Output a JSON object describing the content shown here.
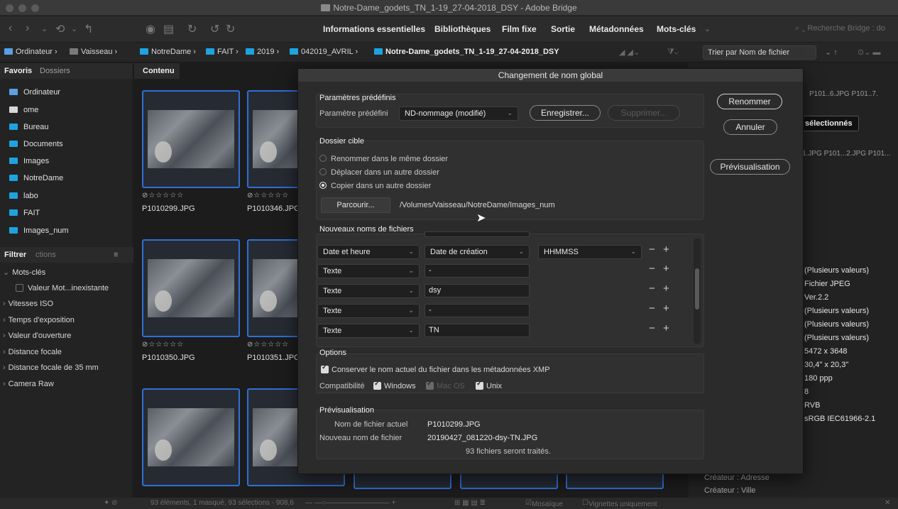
{
  "window": {
    "title": "Notre-Dame_godets_TN_1-19_27-04-2018_DSY - Adobe Bridge"
  },
  "workspaces": [
    "Informations essentielles",
    "Bibliothèques",
    "Film fixe",
    "Sortie",
    "Métadonnées",
    "Mots-clés"
  ],
  "search": {
    "placeholder": "Recherche Bridge : do"
  },
  "path": {
    "crumbs": [
      "Ordinateur",
      "Vaisseau",
      "NotreDame",
      "FAIT",
      "2019",
      "042019_AVRIL",
      "Notre-Dame_godets_TN_1-19_27-04-2018_DSY"
    ]
  },
  "sort": {
    "label": "Trier par Nom de fichier"
  },
  "sidebar": {
    "tabs": [
      "Favoris",
      "Dossiers"
    ],
    "favorites": [
      "Ordinateur",
      "ome",
      "Bureau",
      "Documents",
      "Images",
      "NotreDame",
      "labo",
      "FAIT",
      "Images_num"
    ],
    "filter_tabs": [
      "Filtrer",
      "ctions"
    ],
    "filters": [
      "Mots-clés",
      "Valeur Mot...inexistante",
      "Vitesses ISO",
      "Temps d'exposition",
      "Valeur d'ouverture",
      "Distance focale",
      "Distance focale de 35 mm",
      "Camera Raw"
    ]
  },
  "content": {
    "tab": "Contenu",
    "thumbs": [
      {
        "name": "P1010299.JPG",
        "stars": "⊘☆☆☆☆☆"
      },
      {
        "name": "P1010346.JPG",
        "stars": "⊘☆☆☆☆☆"
      },
      {
        "name": "P1010350.JPG",
        "stars": "⊘☆☆☆☆☆"
      },
      {
        "name": "P1010351.JPG",
        "stars": "⊘☆☆☆☆☆"
      }
    ]
  },
  "right_panel": {
    "top_names": "P101..6.JPG   P101..7.",
    "tooltip": "sélectionnés",
    "row_names": "1.JPG  P101...2.JPG  P101...",
    "meta": [
      "(Plusieurs valeurs)",
      "Fichier JPEG",
      "Ver.2.2",
      "(Plusieurs valeurs)",
      "(Plusieurs valeurs)",
      "(Plusieurs valeurs)",
      "5472 x 3648",
      "30,4\" x 20,3\"",
      "180 ppp",
      "8",
      "RVB",
      "sRGB IEC61966-2.1"
    ],
    "bottom": [
      "Créateur : Adresse",
      "Créateur : Ville"
    ]
  },
  "status": {
    "text": "93 éléments, 1 masqué, 93 sélections - 908,6",
    "view_mosaic": "Mosaïque",
    "view_thumbs": "Vignettes uniquement"
  },
  "dialog": {
    "title": "Changement de nom global",
    "presets": {
      "heading": "Paramètres prédéfinis",
      "label": "Paramètre prédéfini",
      "value": "ND-nommage (modifié)",
      "save": "Enregistrer...",
      "delete": "Supprimer..."
    },
    "target": {
      "heading": "Dossier cible",
      "opt_same": "Renommer dans le même dossier",
      "opt_move": "Déplacer dans un autre dossier",
      "opt_copy": "Copier dans un autre dossier",
      "browse": "Parcourir...",
      "path": "/Volumes/Vaisseau/NotreDame/Images_num"
    },
    "newnames": {
      "heading": "Nouveaux noms de fichiers",
      "rows": [
        {
          "type": "Date et heure",
          "value": "Date de création",
          "format": "HHMMSS"
        },
        {
          "type": "Texte",
          "value": "-"
        },
        {
          "type": "Texte",
          "value": "dsy"
        },
        {
          "type": "Texte",
          "value": "-"
        },
        {
          "type": "Texte",
          "value": "TN"
        }
      ]
    },
    "options": {
      "heading": "Options",
      "keep": "Conserver le nom actuel du fichier dans les métadonnées XMP",
      "compat": "Compatibilité",
      "win": "Windows",
      "mac": "Mac OS",
      "unix": "Unix"
    },
    "preview": {
      "heading": "Prévisualisation",
      "current_label": "Nom de fichier actuel",
      "current": "P1010299.JPG",
      "new_label": "Nouveau nom de fichier",
      "new": "20190427_081220-dsy-TN.JPG",
      "count": "93 fichiers seront traités."
    },
    "buttons": {
      "rename": "Renommer",
      "cancel": "Annuler",
      "preview": "Prévisualisation"
    }
  }
}
